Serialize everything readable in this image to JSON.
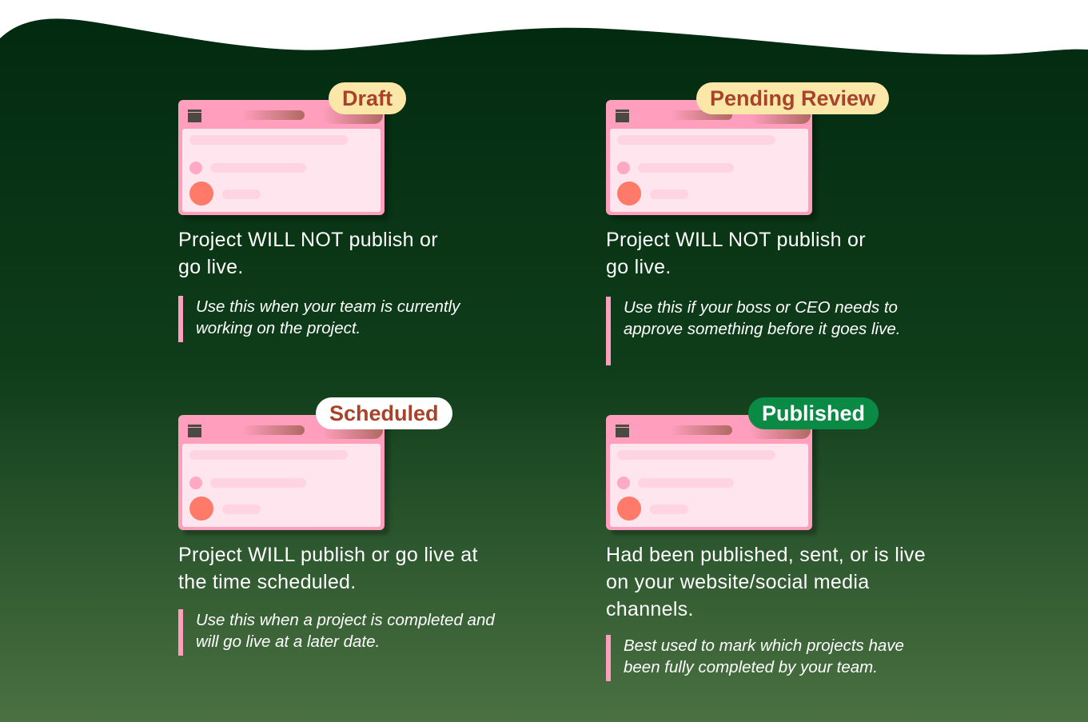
{
  "colors": {
    "bg_top": "#022a10",
    "bg_bottom": "#4b7142",
    "window_pink": "#ff9ebd",
    "accent_coral": "#ff7a68"
  },
  "cards": [
    {
      "badge": "Draft",
      "badge_bg": "#fbe7a8",
      "badge_fg": "#a8432b",
      "desc": "Project WILL NOT publish or go live.",
      "note": "Use this when your team is currently working on the project."
    },
    {
      "badge": "Pending Review",
      "badge_bg": "#fbe7a8",
      "badge_fg": "#a8432b",
      "desc": "Project WILL NOT publish or go live.",
      "note": "Use this if your boss or CEO needs to approve something before it goes live."
    },
    {
      "badge": "Scheduled",
      "badge_bg": "#ffffff",
      "badge_fg": "#a8432b",
      "desc": "Project WILL publish or go live at the time scheduled.",
      "note": "Use this when a project is completed and will go live at a later date."
    },
    {
      "badge": "Published",
      "badge_bg": "#0b8a45",
      "badge_fg": "#ffffff",
      "desc": "Had been published, sent, or is live on your website/social media channels.",
      "note": "Best used to mark which projects have been fully completed by your team."
    }
  ]
}
